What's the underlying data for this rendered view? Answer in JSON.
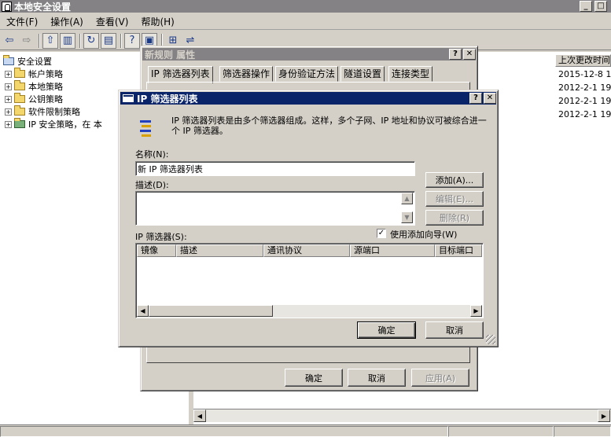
{
  "app": {
    "title": "本地安全设置"
  },
  "menu": [
    "文件(F)",
    "操作(A)",
    "查看(V)",
    "帮助(H)"
  ],
  "tree": {
    "root": "安全设置",
    "items": [
      "帐户策略",
      "本地策略",
      "公钥策略",
      "软件限制策略",
      "IP 安全策略，在 本"
    ]
  },
  "list": {
    "col_last": "上次更改时间",
    "rows": [
      "2015-12-8 1",
      "2012-2-1 19",
      "2012-2-1 19",
      "2012-2-1 19"
    ]
  },
  "rule_dialog": {
    "title": "新规则 属性",
    "tabs": [
      "IP 筛选器列表",
      "筛选器操作",
      "身份验证方法",
      "隧道设置",
      "连接类型"
    ],
    "ok": "确定",
    "cancel": "取消",
    "apply": "应用(A)"
  },
  "filter_dialog": {
    "title": "IP 筛选器列表",
    "description": "IP 筛选器列表是由多个筛选器组成。这样，多个子网、IP 地址和协议可被综合进一个 IP 筛选器。",
    "name_label": "名称(N):",
    "name_value": "新 IP 筛选器列表",
    "desc_label": "描述(D):",
    "add": "添加(A)...",
    "edit": "编辑(E)...",
    "remove": "删除(R)",
    "filters_label": "IP 筛选器(S):",
    "wizard_label": "使用添加向导(W)",
    "wizard_checked": true,
    "columns": [
      "镜像",
      "描述",
      "通讯协议",
      "源端口",
      "目标端口"
    ],
    "ok": "确定",
    "cancel": "取消"
  }
}
